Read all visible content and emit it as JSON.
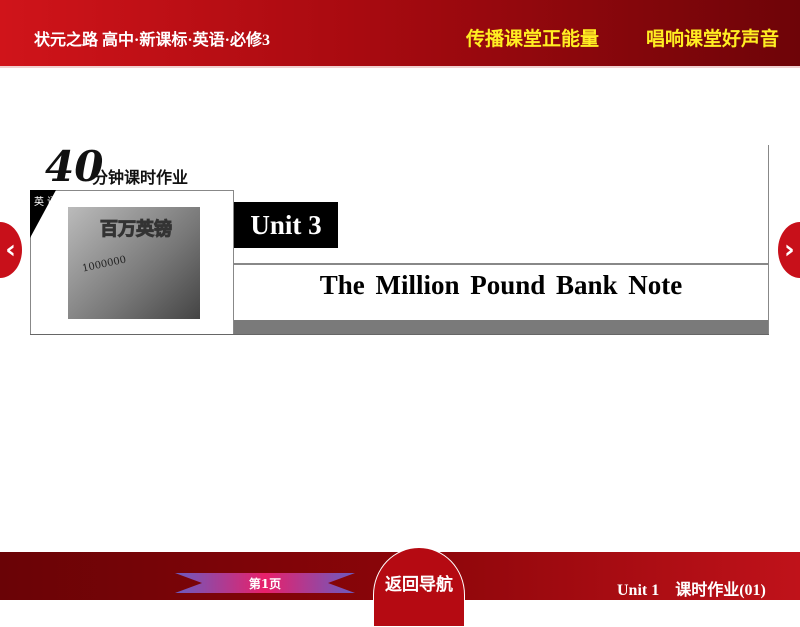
{
  "header": {
    "left_title": "状元之路 高中·新课标·英语·必修3",
    "slogan_1": "传播课堂正能量",
    "slogan_2": "唱响课堂好声音"
  },
  "nav": {
    "prev_icon": "chevron-left-icon",
    "next_icon": "chevron-right-icon",
    "prev_glyph": "‹",
    "next_glyph": "›"
  },
  "badge": {
    "number": "40",
    "text": "分钟课时作业",
    "subject": "英语"
  },
  "poster": {
    "title": "百万英镑",
    "note": "1000000"
  },
  "unit": {
    "label": "Unit 3",
    "title": "The Million Pound Bank Note"
  },
  "footer": {
    "page": "第1页",
    "back": "返回导航",
    "lesson": "Unit 1　课时作业(01)"
  }
}
